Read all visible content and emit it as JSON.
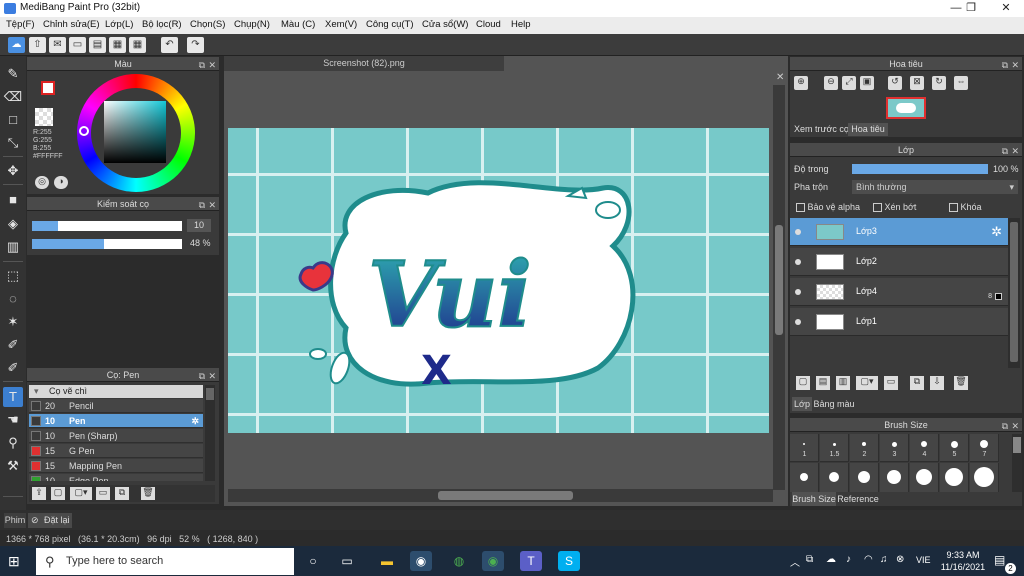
{
  "window": {
    "title": "MediBang Paint Pro (32bit)",
    "min": "—",
    "max": "❐",
    "close": "✕"
  },
  "menu": [
    "Tệp(F)",
    "Chỉnh sửa(E)",
    "Lớp(L)",
    "Bộ lọc(R)",
    "Chọn(S)",
    "Chụp(N)",
    "Màu (C)",
    "Xem(V)",
    "Công cụ(T)",
    "Cửa sổ(W)",
    "Cloud",
    "Help"
  ],
  "color_panel": {
    "title": "Màu",
    "r": "R:255",
    "g": "G:255",
    "b": "B:255",
    "hex": "#FFFFFF"
  },
  "brush_control": {
    "title": "Kiểm soát cọ",
    "size": "10",
    "opacity": "48 %",
    "opacity_fraction": 0.48,
    "size_fraction": 0.17
  },
  "brush_panel": {
    "title": "Cọ: Pen",
    "group": "Cọ vẽ chì",
    "items": [
      {
        "size": "20",
        "name": "Pencil",
        "color": "#3a3a3a"
      },
      {
        "size": "10",
        "name": "Pen",
        "color": "#3a3a3a"
      },
      {
        "size": "10",
        "name": "Pen (Sharp)",
        "color": "#3a3a3a"
      },
      {
        "size": "15",
        "name": "G Pen",
        "color": "#e03030"
      },
      {
        "size": "15",
        "name": "Mapping Pen",
        "color": "#e03030"
      },
      {
        "size": "10",
        "name": "Edge Pen",
        "color": "#30a030"
      }
    ]
  },
  "document": {
    "tab": "Screenshot (82).png"
  },
  "artwork": {
    "word": "Vui",
    "mark": "X"
  },
  "navigator": {
    "title": "Hoa tiêu",
    "tab_preview": "Xem trước cọ",
    "tab_nav": "Hoa tiêu"
  },
  "layers": {
    "title": "Lớp",
    "opacity_label": "Độ trong",
    "opacity_value": "100 %",
    "blend_label": "Pha trộn",
    "blend_value": "Bình thường",
    "protect_alpha": "Bảo vệ alpha",
    "clip": "Xén bớt",
    "lock": "Khóa",
    "items": [
      {
        "name": "Lớp3"
      },
      {
        "name": "Lớp2"
      },
      {
        "name": "Lớp4",
        "badge": "8"
      },
      {
        "name": "Lớp1"
      }
    ],
    "tab_layer": "Lớp",
    "tab_material": "Bảng màu"
  },
  "brush_size": {
    "title": "Brush Size",
    "sizes": [
      "1",
      "1.5",
      "2",
      "3",
      "4",
      "5",
      "7"
    ],
    "tab_size": "Brush Size",
    "tab_ref": "Reference"
  },
  "bottom": {
    "filter_tab": "Phim",
    "reset": "Đặt lại"
  },
  "status": {
    "text": "1366 * 768 pixel   (36.1 * 20.3cm)   96 dpi   52 %   ( 1268, 840 )"
  },
  "taskbar": {
    "search": "Type here to search",
    "lang": "VIE",
    "time": "9:33 AM",
    "date": "11/16/2021",
    "notif": "2"
  }
}
